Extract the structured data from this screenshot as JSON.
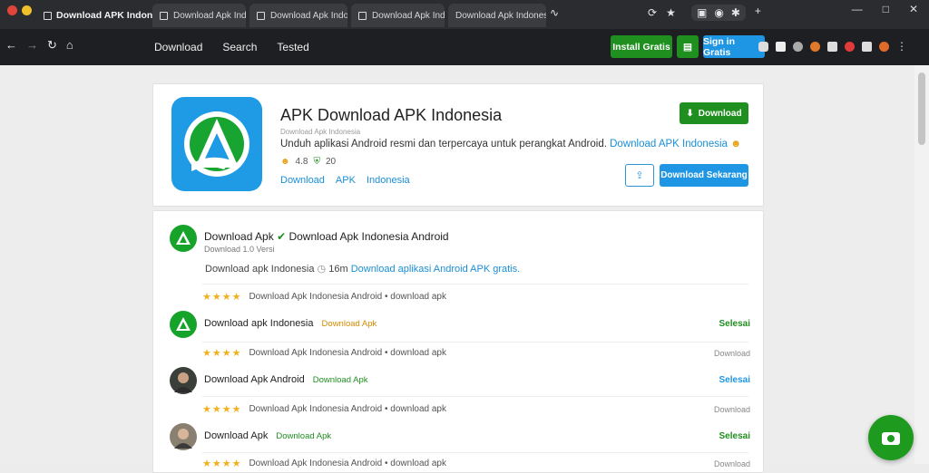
{
  "browser": {
    "active_tab_title": "Download APK Indonesia",
    "tabs": [
      {
        "title": "Download Apk Indonesia"
      },
      {
        "title": "Download Apk Indonesia"
      },
      {
        "title": "Download Apk Indonesia"
      },
      {
        "title": "Download Apk Indonesia"
      }
    ],
    "tab_close_glyph": "✕",
    "new_tab_glyph": "+"
  },
  "site_nav": {
    "items": [
      "Download",
      "Search",
      "Tested"
    ],
    "header_download_label": "Install Gratis",
    "header_signin_label": "Sign in Gratis"
  },
  "app": {
    "title": "APK Download APK Indonesia",
    "subtitle": "Download Apk Indonesia",
    "description": "Unduh aplikasi Android resmi dan terpercaya untuk perangkat Android.",
    "description_link": "Download APK Indonesia",
    "rating": "4.8",
    "reviews_count": "20",
    "breadcrumbs": [
      "Download",
      "APK",
      "Indonesia"
    ],
    "install_label": "Download",
    "share_label": "Download Sekarang"
  },
  "reviews": {
    "header_name": "Download Apk",
    "header_title": "Download Apk Indonesia Android",
    "header_date": "Download 1.0 Versi",
    "summary_text": "Download apk Indonesia",
    "summary_count": "16m",
    "summary_link": "Download aplikasi Android APK gratis.",
    "lines": [
      "Download Apk Indonesia Android • download apk",
      "Download Apk Indonesia Android • download apk",
      "Download Apk Indonesia Android • download apk",
      "Download Apk Indonesia Android • download apk"
    ],
    "line_action": "Download",
    "items": [
      {
        "name": "Download apk Indonesia",
        "tag": "Download Apk",
        "action": "Selesai",
        "tag_color": "#d68b00",
        "action_color": "#1f8f1f"
      },
      {
        "name": "Download Apk Android",
        "tag": "Download Apk",
        "action": "Selesai",
        "tag_color": "#1f8f1f",
        "action_color": "#1e96e3"
      },
      {
        "name": "Download Apk",
        "tag": "Download Apk",
        "action": "Selesai",
        "tag_color": "#1f8f1f",
        "action_color": "#1f8f1f"
      }
    ]
  },
  "colors": {
    "green": "#1f8f1f",
    "blue": "#1e96e3",
    "star": "#f2b01e"
  }
}
